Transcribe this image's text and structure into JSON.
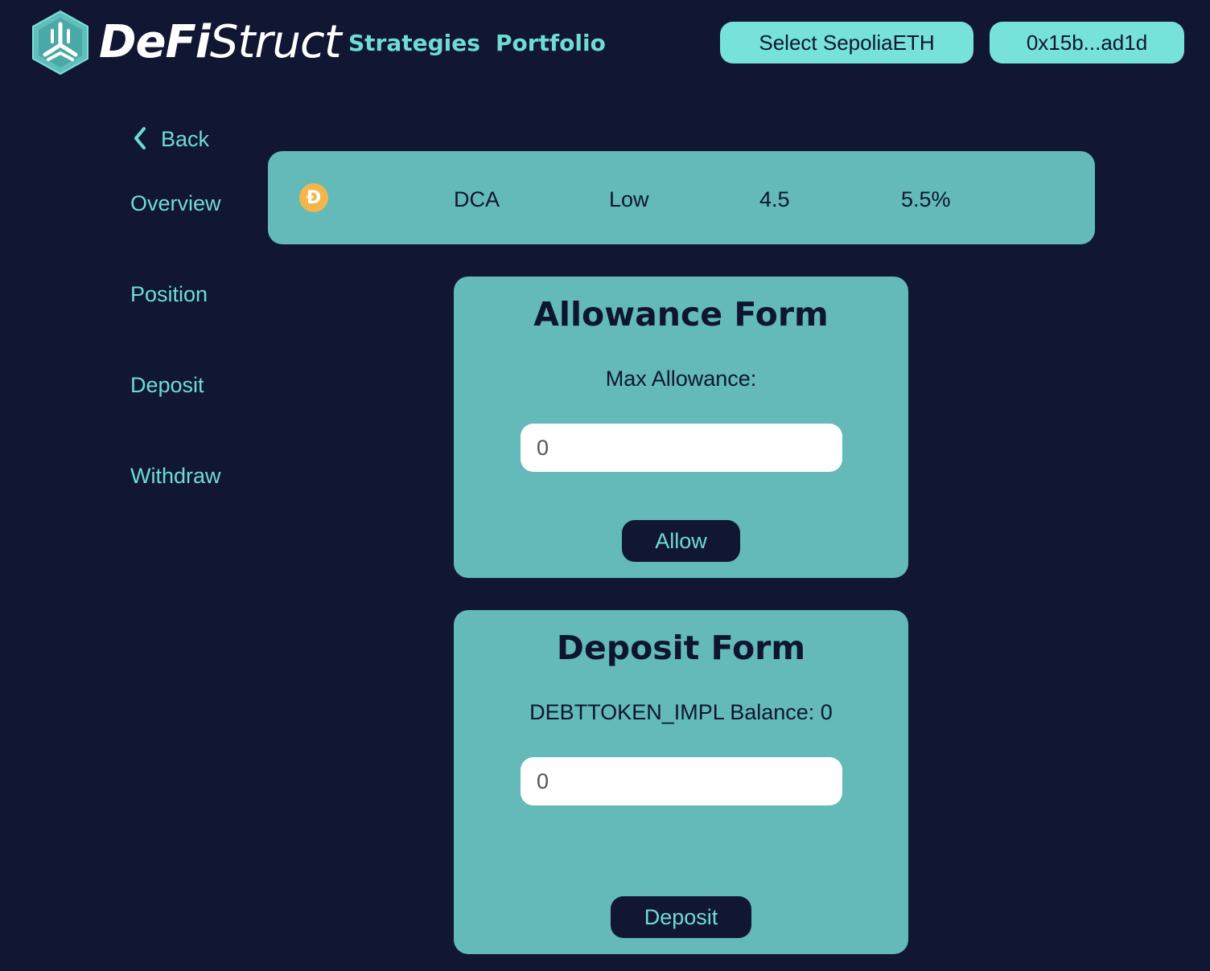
{
  "header": {
    "logo": {
      "bold_text": "DeFi",
      "light_text": "Struct",
      "icon": "defistruct-logo-icon"
    },
    "nav": [
      {
        "label": "Strategies"
      },
      {
        "label": "Portfolio"
      }
    ],
    "network_button_label": "Select SepoliaETH",
    "wallet_button_label": "0x15b...ad1d"
  },
  "sidebar": {
    "back_label": "Back",
    "back_icon": "chevron-left-icon",
    "items": [
      {
        "label": "Overview"
      },
      {
        "label": "Position"
      },
      {
        "label": "Deposit"
      },
      {
        "label": "Withdraw"
      }
    ]
  },
  "summary": {
    "token_icon": "dai-token-icon",
    "token_symbol": "Đ",
    "strategy": "DCA",
    "risk": "Low",
    "score": "4.5",
    "apy": "5.5%"
  },
  "allowance_form": {
    "title": "Allowance Form",
    "label": "Max Allowance:",
    "input_placeholder": "0",
    "button_label": "Allow"
  },
  "deposit_form": {
    "title": "Deposit Form",
    "label": "DEBTTOKEN_IMPL Balance: 0",
    "input_placeholder": "0",
    "button_label": "Deposit"
  },
  "colors": {
    "background": "#111632",
    "accent": "#6fdcd3",
    "card": "#63bab8",
    "pill": "#76e2da",
    "token": "#f4b54a"
  }
}
